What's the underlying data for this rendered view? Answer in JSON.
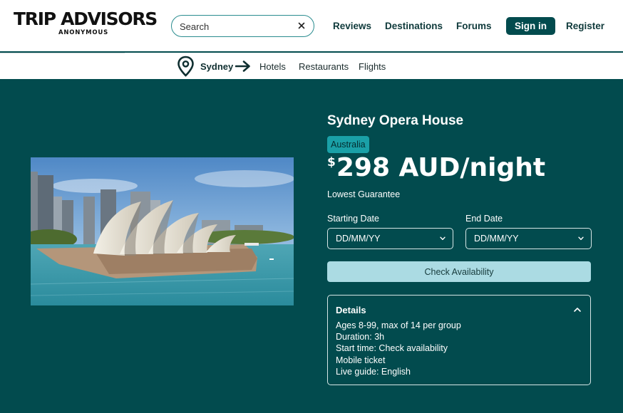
{
  "brand": {
    "name": "TRIP ADVISORS",
    "tagline": "ANONYMOUS"
  },
  "search": {
    "placeholder": "Search",
    "value": ""
  },
  "nav": {
    "links": [
      "Reviews",
      "Destinations",
      "Forums"
    ],
    "signin": "Sign in",
    "register": "Register"
  },
  "subnav": {
    "city": "Sydney",
    "links": [
      "Hotels",
      "Restaurants",
      "Flights"
    ]
  },
  "listing": {
    "title": "Sydney Opera House",
    "country": "Australia",
    "currency_symbol": "$",
    "price": "298 AUD/night",
    "guarantee": "Lowest Guarantee",
    "start_label": "Starting Date",
    "start_value": "DD/MM/YY",
    "end_label": "End Date",
    "end_value": "DD/MM/YY",
    "check_button": "Check Availability",
    "details_title": "Details",
    "details": [
      "Ages 8-99, max of 14 per group",
      "Duration: 3h",
      "Start time: Check availability",
      "Mobile ticket",
      "Live guide: English"
    ]
  },
  "colors": {
    "primary": "#024b4e",
    "badge": "#1aa0a7",
    "button": "#abdbe3"
  }
}
